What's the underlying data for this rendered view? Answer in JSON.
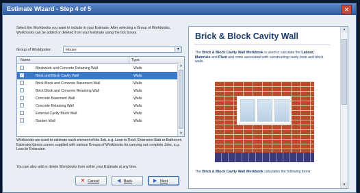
{
  "window": {
    "title": "Estimate Wizard - Step 4 of 5"
  },
  "left": {
    "instructions": "Select the Workbooks you want to include in your Estimate. After selecting a Group of Workbooks, Workbooks can be added or deleted from your Estimate using the tick boxes.",
    "group_label": "Group of Workbooks:",
    "group_value": "House",
    "columns": {
      "name": "Name",
      "type": "Type"
    },
    "rows": [
      {
        "name": "Blockwork and Concrete Retaining Wall",
        "type": "Walls",
        "checked": false,
        "selected": false
      },
      {
        "name": "Brick and Block Cavity Wall",
        "type": "Walls",
        "checked": true,
        "selected": true
      },
      {
        "name": "Brick Block and Concrete Basement Wall",
        "type": "Walls",
        "checked": false,
        "selected": false
      },
      {
        "name": "Brick Block and Concrete Retaining Wall",
        "type": "Walls",
        "checked": false,
        "selected": false
      },
      {
        "name": "Concrete Basement Wall",
        "type": "Walls",
        "checked": false,
        "selected": false
      },
      {
        "name": "Concrete Retaining Wall",
        "type": "Walls",
        "checked": false,
        "selected": false
      },
      {
        "name": "External Cavity Block Wall",
        "type": "Walls",
        "checked": false,
        "selected": false
      },
      {
        "name": "Garden Wall",
        "type": "Walls",
        "checked": false,
        "selected": false
      }
    ],
    "note1": "Workbooks are used to estimate each element of the Job, e.g. Lean to Roof, Extension Slab or Bathroom. EstimatorXpress comes supplied with various Groups of Workbooks for carrying out complete Jobs, e.g. Lean to Extension.",
    "note2": "You can also add or delete Workbooks from within your Estimate at any time."
  },
  "buttons": {
    "cancel": "Cancel",
    "back": "Back",
    "next": "Next"
  },
  "right": {
    "title": "Brick & Block Cavity Wall",
    "desc_pre": "The ",
    "desc_bold1": "Brick & Block Cavity Wall Workbook",
    "desc_mid1": " is used to calculate the ",
    "desc_bold2": "Labour, Materials",
    "desc_mid2": " and ",
    "desc_bold3": "Plant",
    "desc_post": " and costs associated with constructing cavity brick and block walls.",
    "footer_pre": "The ",
    "footer_bold": "Brick & Block Cavity Wall Workbook",
    "footer_post": " calculates the following items:"
  }
}
